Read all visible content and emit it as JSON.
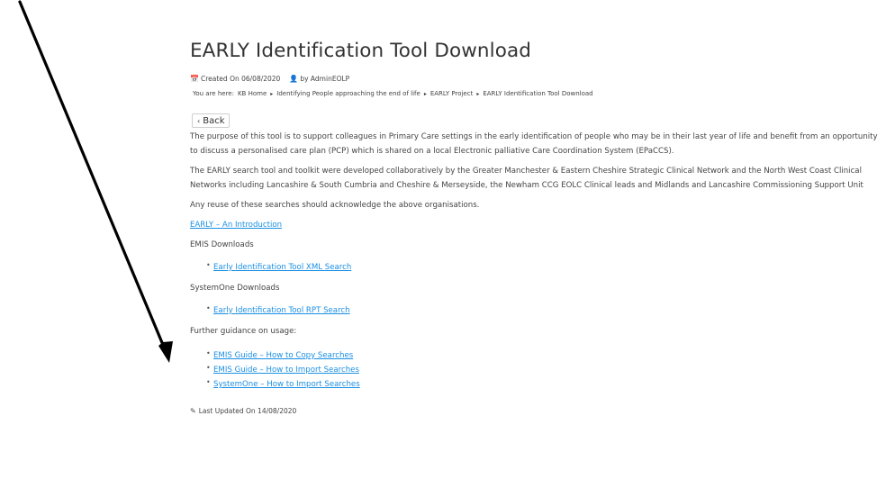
{
  "page": {
    "title": "EARLY Identification Tool Download"
  },
  "meta": {
    "calendar_icon": "calendar-icon",
    "created": "Created On 06/08/2020",
    "user_icon": "user-icon",
    "author": "by AdminEOLP"
  },
  "breadcrumb": {
    "lead": "You are here:",
    "items": [
      "KB Home",
      "Identifying People approaching the end of life",
      "EARLY Project",
      "EARLY Identification Tool Download"
    ],
    "separator": "▸"
  },
  "back": {
    "icon": "chevron-left-icon",
    "label": "Back"
  },
  "body": {
    "p1": "The purpose of this tool is to support colleagues in Primary Care settings in the early identification of people who may be in their last year of life and benefit from an opportunity to discuss a personalised care plan (PCP) which is shared on a local Electronic palliative Care Coordination System (EPaCCS).",
    "p2": "The EARLY search tool and toolkit were developed collaboratively by the Greater Manchester & Eastern Cheshire Strategic Clinical Network and the North West Coast Clinical Networks including Lancashire & South Cumbria and Cheshire & Merseyside, the Newham CCG EOLC Clinical leads and Midlands and Lancashire Commissioning Support Unit",
    "p3": "Any reuse of these searches should acknowledge the above organisations.",
    "intro_link": "EARLY – An Introduction",
    "emis_label": "EMIS Downloads",
    "emis_link": "Early Identification Tool XML Search",
    "systemone_label": "SystemOne Downloads",
    "systemone_link": "Early Identification Tool RPT Search",
    "guidance_label": "Further guidance on usage:",
    "guidance_links": [
      "EMIS Guide – How to Copy Searches",
      "EMIS Guide – How to Import Searches",
      "SystemOne – How to Import Searches"
    ]
  },
  "footer": {
    "edit_icon": "edit-icon",
    "updated": "Last Updated On 14/08/2020"
  },
  "annotation": {
    "arrow_color": "#000000"
  },
  "colors": {
    "link": "#1a8fe3",
    "text": "#444444",
    "title": "#333333"
  }
}
